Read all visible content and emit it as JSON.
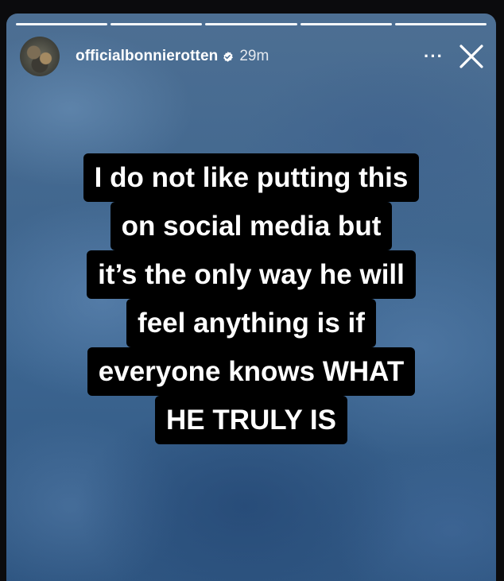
{
  "story": {
    "progress": {
      "segments": 5,
      "completed": 5
    },
    "account": {
      "username": "officialbonnierotten",
      "verified": true,
      "time_ago": "29m",
      "avatar_icon": "avatar"
    },
    "actions": {
      "more_label": "···",
      "close_icon": "close-icon"
    },
    "caption_lines": [
      "I do not like putting this",
      "on social media but",
      "it’s the only way he will",
      "feel anything is if",
      "everyone knows WHAT",
      "HE TRULY IS"
    ],
    "colors": {
      "background": "#41678f",
      "caption_bg": "#000000",
      "caption_text": "#ffffff"
    }
  }
}
